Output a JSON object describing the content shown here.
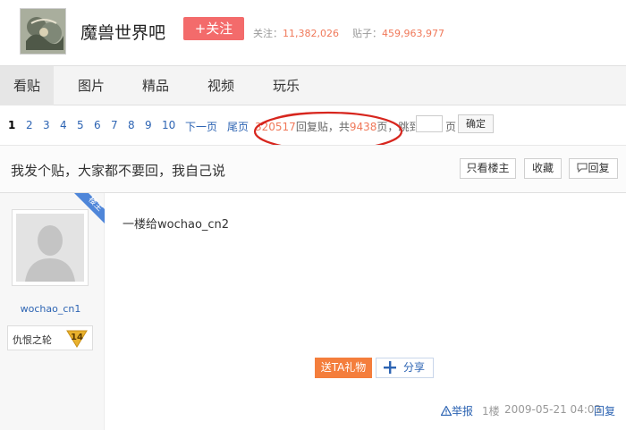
{
  "header": {
    "forum_name": "魔兽世界吧",
    "follow_label": "+关注",
    "follow_stat_label": "关注：",
    "follow_count": "11,382,026",
    "post_stat_label": "贴子：",
    "post_count": "459,963,977"
  },
  "tabs": [
    {
      "label": "看贴",
      "active": true
    },
    {
      "label": "图片"
    },
    {
      "label": "精品"
    },
    {
      "label": "视频"
    },
    {
      "label": "玩乐"
    }
  ],
  "pager": {
    "pages": [
      "1",
      "2",
      "3",
      "4",
      "5",
      "6",
      "7",
      "8",
      "9",
      "10"
    ],
    "current": "1",
    "next_label": "下一页",
    "last_label": "尾页",
    "reply_count": "320517",
    "reply_text": "回复贴，共",
    "page_count": "9438",
    "page_text": "页，",
    "jump_label": "跳到",
    "page_unit": "页",
    "confirm_label": "确定"
  },
  "thread": {
    "title": "我发个贴，大家都不要回，我自己说",
    "only_op_label": "只看楼主",
    "favorite_label": "收藏",
    "reply_label": "回复"
  },
  "post": {
    "op_badge": "楼主",
    "username": "wochao_cn1",
    "level_name": "仇恨之轮",
    "level": "14",
    "content": "一楼给wochao_cn2",
    "gift_label": "送TA礼物",
    "share_label": "分享",
    "report_label": "举报",
    "floor": "1楼",
    "time": "2009-05-21 04:03",
    "reply_label": "回复"
  },
  "colors": {
    "accent_red": "#f36b6b",
    "link_blue": "#2d64b3",
    "number_orange": "#f0795a",
    "gift_orange": "#f47e3c",
    "annotation_red": "#d7261e",
    "badge_blue": "#4f86d9",
    "level_gold": "#e9b22d"
  },
  "icons": {
    "report": "warning-triangle-icon",
    "share": "plus-cross-icon",
    "reply": "speech-bubble-icon"
  }
}
